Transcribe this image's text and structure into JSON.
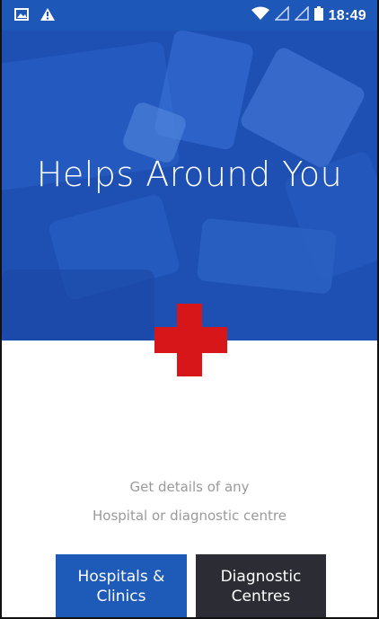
{
  "status_bar": {
    "time": "18:49",
    "icons": [
      "image-icon",
      "warning-icon",
      "wifi-icon",
      "signal-icon",
      "signal-icon",
      "battery-icon"
    ]
  },
  "hero": {
    "title": "Helps Around You"
  },
  "description": {
    "line1": "Get details of any",
    "line2": "Hospital or diagnostic centre"
  },
  "buttons": {
    "hospitals": "Hospitals &\nClinics",
    "diagnostic": "Diagnostic\nCentres"
  },
  "colors": {
    "hero_bg": "#1e4fb3",
    "cross": "#d61618",
    "hospitals_button": "#1e5ab8",
    "diagnostic_button": "#2c2c35"
  }
}
